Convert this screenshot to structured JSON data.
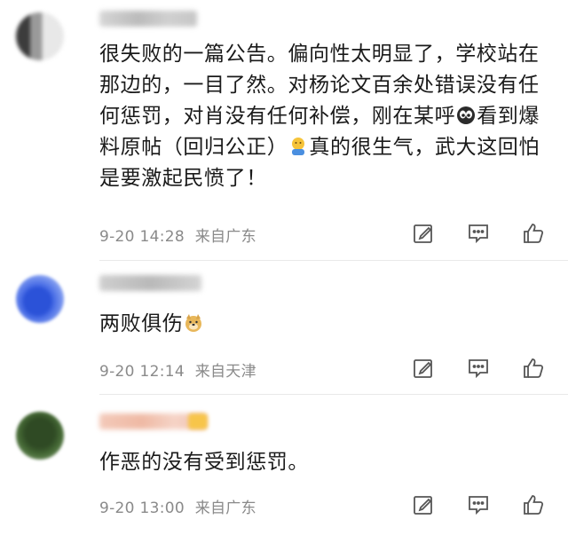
{
  "comments": [
    {
      "text_parts": [
        "很失败的一篇公告。偏向性太明显了，学校站在那边的，一目了然。对杨论文百余处错误没有任何惩罚，对肖没有任何补偿，刚在某呼",
        "看到爆料原帖（回归公正）",
        "真的很生气，武大这回怕是要激起民愤了！"
      ],
      "emojis": [
        "eyes-emoji",
        "thinking-emoji"
      ],
      "time": "9-20 14:28",
      "location": "来自广东"
    },
    {
      "text_parts": [
        "两败俱伤"
      ],
      "emojis": [
        "doge-emoji"
      ],
      "time": "9-20 12:14",
      "location": "来自天津"
    },
    {
      "text_parts": [
        "作恶的没有受到惩罚。"
      ],
      "emojis": [],
      "time": "9-20 13:00",
      "location": "来自广东"
    }
  ],
  "icons": {
    "repost": "edit-icon",
    "reply": "comment-icon",
    "like": "thumbs-up-icon"
  },
  "colors": {
    "text": "#1a1a1a",
    "meta": "#8a8a8a",
    "icon": "#555555"
  }
}
